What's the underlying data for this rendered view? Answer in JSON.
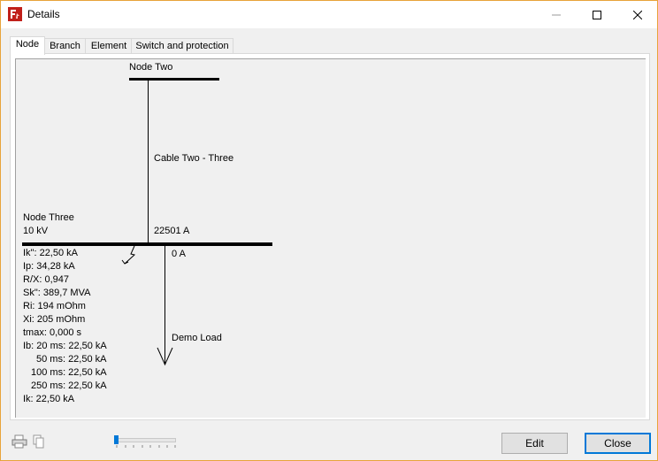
{
  "window": {
    "title": "Details"
  },
  "tabs": [
    {
      "label": "Node"
    },
    {
      "label": "Branch"
    },
    {
      "label": "Element"
    },
    {
      "label": "Switch and protection"
    }
  ],
  "diagram": {
    "top_node": "Node Two",
    "cable": "Cable Two - Three",
    "node_name": "Node Three",
    "node_voltage": "10 kV",
    "cable_current": "22501 A",
    "load_current": "0 A",
    "load_name": "Demo Load",
    "results": [
      "Ik\": 22,50 kA",
      "Ip: 34,28 kA",
      "R/X: 0,947",
      "Sk\": 389,7 MVA",
      "Ri: 194 mOhm",
      "Xi: 205 mOhm",
      "tmax: 0,000 s",
      "Ib: 20 ms: 22,50 kA",
      "50 ms: 22,50 kA",
      "100 ms: 22,50 kA",
      "250 ms: 22,50 kA",
      "Ik: 22,50 kA"
    ]
  },
  "footer": {
    "edit_label": "Edit",
    "close_label": "Close",
    "zoom_level": 0
  },
  "icons": {
    "app": "app-logo-icon",
    "print": "printer-icon",
    "copy": "copy-icon",
    "minimize": "minimize-icon",
    "maximize": "maximize-icon",
    "close": "close-icon"
  }
}
